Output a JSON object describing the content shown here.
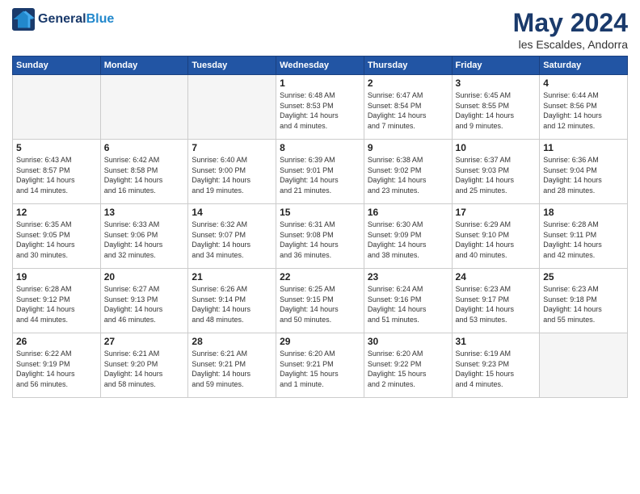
{
  "header": {
    "logo_line1": "General",
    "logo_line2": "Blue",
    "month": "May 2024",
    "location": "les Escaldes, Andorra"
  },
  "days_of_week": [
    "Sunday",
    "Monday",
    "Tuesday",
    "Wednesday",
    "Thursday",
    "Friday",
    "Saturday"
  ],
  "weeks": [
    [
      {
        "day": "",
        "info": "",
        "empty": true
      },
      {
        "day": "",
        "info": "",
        "empty": true
      },
      {
        "day": "",
        "info": "",
        "empty": true
      },
      {
        "day": "1",
        "info": "Sunrise: 6:48 AM\nSunset: 8:53 PM\nDaylight: 14 hours\nand 4 minutes."
      },
      {
        "day": "2",
        "info": "Sunrise: 6:47 AM\nSunset: 8:54 PM\nDaylight: 14 hours\nand 7 minutes."
      },
      {
        "day": "3",
        "info": "Sunrise: 6:45 AM\nSunset: 8:55 PM\nDaylight: 14 hours\nand 9 minutes."
      },
      {
        "day": "4",
        "info": "Sunrise: 6:44 AM\nSunset: 8:56 PM\nDaylight: 14 hours\nand 12 minutes."
      }
    ],
    [
      {
        "day": "5",
        "info": "Sunrise: 6:43 AM\nSunset: 8:57 PM\nDaylight: 14 hours\nand 14 minutes."
      },
      {
        "day": "6",
        "info": "Sunrise: 6:42 AM\nSunset: 8:58 PM\nDaylight: 14 hours\nand 16 minutes."
      },
      {
        "day": "7",
        "info": "Sunrise: 6:40 AM\nSunset: 9:00 PM\nDaylight: 14 hours\nand 19 minutes."
      },
      {
        "day": "8",
        "info": "Sunrise: 6:39 AM\nSunset: 9:01 PM\nDaylight: 14 hours\nand 21 minutes."
      },
      {
        "day": "9",
        "info": "Sunrise: 6:38 AM\nSunset: 9:02 PM\nDaylight: 14 hours\nand 23 minutes."
      },
      {
        "day": "10",
        "info": "Sunrise: 6:37 AM\nSunset: 9:03 PM\nDaylight: 14 hours\nand 25 minutes."
      },
      {
        "day": "11",
        "info": "Sunrise: 6:36 AM\nSunset: 9:04 PM\nDaylight: 14 hours\nand 28 minutes."
      }
    ],
    [
      {
        "day": "12",
        "info": "Sunrise: 6:35 AM\nSunset: 9:05 PM\nDaylight: 14 hours\nand 30 minutes."
      },
      {
        "day": "13",
        "info": "Sunrise: 6:33 AM\nSunset: 9:06 PM\nDaylight: 14 hours\nand 32 minutes."
      },
      {
        "day": "14",
        "info": "Sunrise: 6:32 AM\nSunset: 9:07 PM\nDaylight: 14 hours\nand 34 minutes."
      },
      {
        "day": "15",
        "info": "Sunrise: 6:31 AM\nSunset: 9:08 PM\nDaylight: 14 hours\nand 36 minutes."
      },
      {
        "day": "16",
        "info": "Sunrise: 6:30 AM\nSunset: 9:09 PM\nDaylight: 14 hours\nand 38 minutes."
      },
      {
        "day": "17",
        "info": "Sunrise: 6:29 AM\nSunset: 9:10 PM\nDaylight: 14 hours\nand 40 minutes."
      },
      {
        "day": "18",
        "info": "Sunrise: 6:28 AM\nSunset: 9:11 PM\nDaylight: 14 hours\nand 42 minutes."
      }
    ],
    [
      {
        "day": "19",
        "info": "Sunrise: 6:28 AM\nSunset: 9:12 PM\nDaylight: 14 hours\nand 44 minutes."
      },
      {
        "day": "20",
        "info": "Sunrise: 6:27 AM\nSunset: 9:13 PM\nDaylight: 14 hours\nand 46 minutes."
      },
      {
        "day": "21",
        "info": "Sunrise: 6:26 AM\nSunset: 9:14 PM\nDaylight: 14 hours\nand 48 minutes."
      },
      {
        "day": "22",
        "info": "Sunrise: 6:25 AM\nSunset: 9:15 PM\nDaylight: 14 hours\nand 50 minutes."
      },
      {
        "day": "23",
        "info": "Sunrise: 6:24 AM\nSunset: 9:16 PM\nDaylight: 14 hours\nand 51 minutes."
      },
      {
        "day": "24",
        "info": "Sunrise: 6:23 AM\nSunset: 9:17 PM\nDaylight: 14 hours\nand 53 minutes."
      },
      {
        "day": "25",
        "info": "Sunrise: 6:23 AM\nSunset: 9:18 PM\nDaylight: 14 hours\nand 55 minutes."
      }
    ],
    [
      {
        "day": "26",
        "info": "Sunrise: 6:22 AM\nSunset: 9:19 PM\nDaylight: 14 hours\nand 56 minutes."
      },
      {
        "day": "27",
        "info": "Sunrise: 6:21 AM\nSunset: 9:20 PM\nDaylight: 14 hours\nand 58 minutes."
      },
      {
        "day": "28",
        "info": "Sunrise: 6:21 AM\nSunset: 9:21 PM\nDaylight: 14 hours\nand 59 minutes."
      },
      {
        "day": "29",
        "info": "Sunrise: 6:20 AM\nSunset: 9:21 PM\nDaylight: 15 hours\nand 1 minute."
      },
      {
        "day": "30",
        "info": "Sunrise: 6:20 AM\nSunset: 9:22 PM\nDaylight: 15 hours\nand 2 minutes."
      },
      {
        "day": "31",
        "info": "Sunrise: 6:19 AM\nSunset: 9:23 PM\nDaylight: 15 hours\nand 4 minutes."
      },
      {
        "day": "",
        "info": "",
        "empty": true
      }
    ]
  ]
}
